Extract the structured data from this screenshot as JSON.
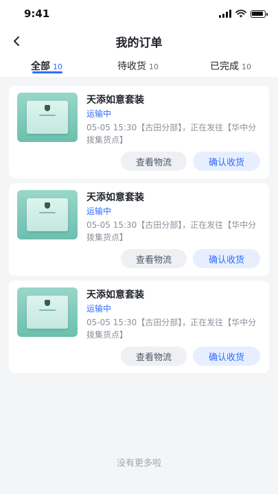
{
  "status_bar": {
    "time": "9:41"
  },
  "header": {
    "title": "我的订单",
    "back_icon": "chevron-left-icon"
  },
  "tabs": [
    {
      "label": "全部",
      "count": "10",
      "active": true
    },
    {
      "label": "待收货",
      "count": "10",
      "active": false
    },
    {
      "label": "已完成",
      "count": "10",
      "active": false
    }
  ],
  "orders": [
    {
      "title": "天添如意套装",
      "status": "运输中",
      "tracking": "05-05 15:30【古田分部】，正在发往【华中分拨集货点】",
      "buttons": {
        "logistics": "查看物流",
        "confirm": "确认收货"
      }
    },
    {
      "title": "天添如意套装",
      "status": "运输中",
      "tracking": "05-05 15:30【古田分部】，正在发往【华中分拨集货点】",
      "buttons": {
        "logistics": "查看物流",
        "confirm": "确认收货"
      }
    },
    {
      "title": "天添如意套装",
      "status": "运输中",
      "tracking": "05-05 15:30【古田分部】，正在发往【华中分拨集货点】",
      "buttons": {
        "logistics": "查看物流",
        "confirm": "确认收货"
      }
    }
  ],
  "footer": {
    "text": "没有更多啦"
  },
  "colors": {
    "accent": "#2f6bff",
    "status": "#2f6bff",
    "background": "#f4f5f7"
  }
}
